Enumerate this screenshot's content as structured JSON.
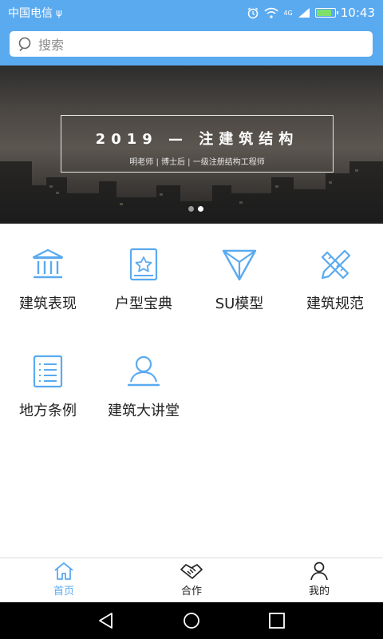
{
  "status": {
    "carrier": "中国电信",
    "usb": "ψ",
    "time": "10:43",
    "network": "4G",
    "battery_level": 0.85
  },
  "search": {
    "placeholder": "搜索"
  },
  "banner": {
    "title": "2019 — 注建筑结构",
    "subtitle": "明老师 | 博士后 | 一级注册结构工程师",
    "active_dot": 1,
    "dot_count": 2
  },
  "features": [
    {
      "label": "建筑表现",
      "icon": "bank-icon"
    },
    {
      "label": "户型宝典",
      "icon": "star-book-icon"
    },
    {
      "label": "SU模型",
      "icon": "triangle-icon"
    },
    {
      "label": "建筑规范",
      "icon": "ruler-pencil-icon"
    },
    {
      "label": "地方条例",
      "icon": "list-document-icon"
    },
    {
      "label": "建筑大讲堂",
      "icon": "lecturer-icon"
    }
  ],
  "tabs": [
    {
      "label": "首页",
      "icon": "home-icon",
      "active": true
    },
    {
      "label": "合作",
      "icon": "handshake-icon",
      "active": false
    },
    {
      "label": "我的",
      "icon": "user-icon",
      "active": false
    }
  ],
  "colors": {
    "accent": "#5aaaf0",
    "icon": "#5aaaf0",
    "text": "#222222"
  }
}
